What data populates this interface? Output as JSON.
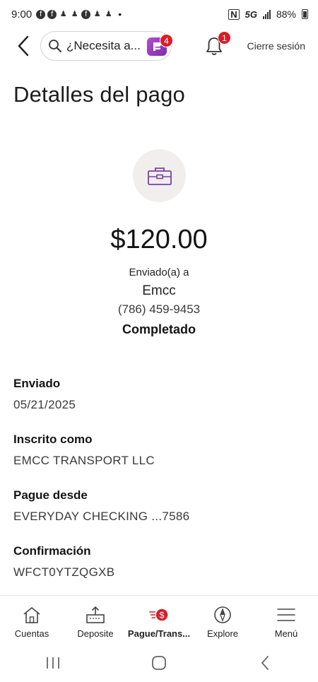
{
  "status_bar": {
    "time": "9:00",
    "network": "5G",
    "battery": "88%"
  },
  "header": {
    "search_placeholder": "¿Necesita a...",
    "assistant_badge": "4",
    "notifications_badge": "1",
    "logout_label": "Cierre sesión"
  },
  "page": {
    "title": "Detalles del pago"
  },
  "summary": {
    "amount": "$120.00",
    "sent_to_label": "Enviado(a) a",
    "recipient_name": "Emcc",
    "recipient_phone": "(786) 459-9453",
    "status": "Completado"
  },
  "details": [
    {
      "label": "Enviado",
      "value": "05/21/2025"
    },
    {
      "label": "Inscrito como",
      "value": "EMCC TRANSPORT LLC"
    },
    {
      "label": "Pague desde",
      "value": "EVERYDAY CHECKING ...7586"
    },
    {
      "label": "Confirmación",
      "value": "WFCT0YTZQGXB"
    }
  ],
  "bottom_nav": [
    {
      "label": "Cuentas",
      "icon": "home-icon"
    },
    {
      "label": "Deposite",
      "icon": "deposit-icon"
    },
    {
      "label": "Pague/Trans...",
      "icon": "pay-transfer-icon",
      "active": true
    },
    {
      "label": "Explore",
      "icon": "compass-icon"
    },
    {
      "label": "Menú",
      "icon": "hamburger-menu-icon"
    }
  ],
  "colors": {
    "accent_red": "#d71e28",
    "assistant_purple": "#8a35bd",
    "briefcase_purple": "#7b3fa6"
  }
}
